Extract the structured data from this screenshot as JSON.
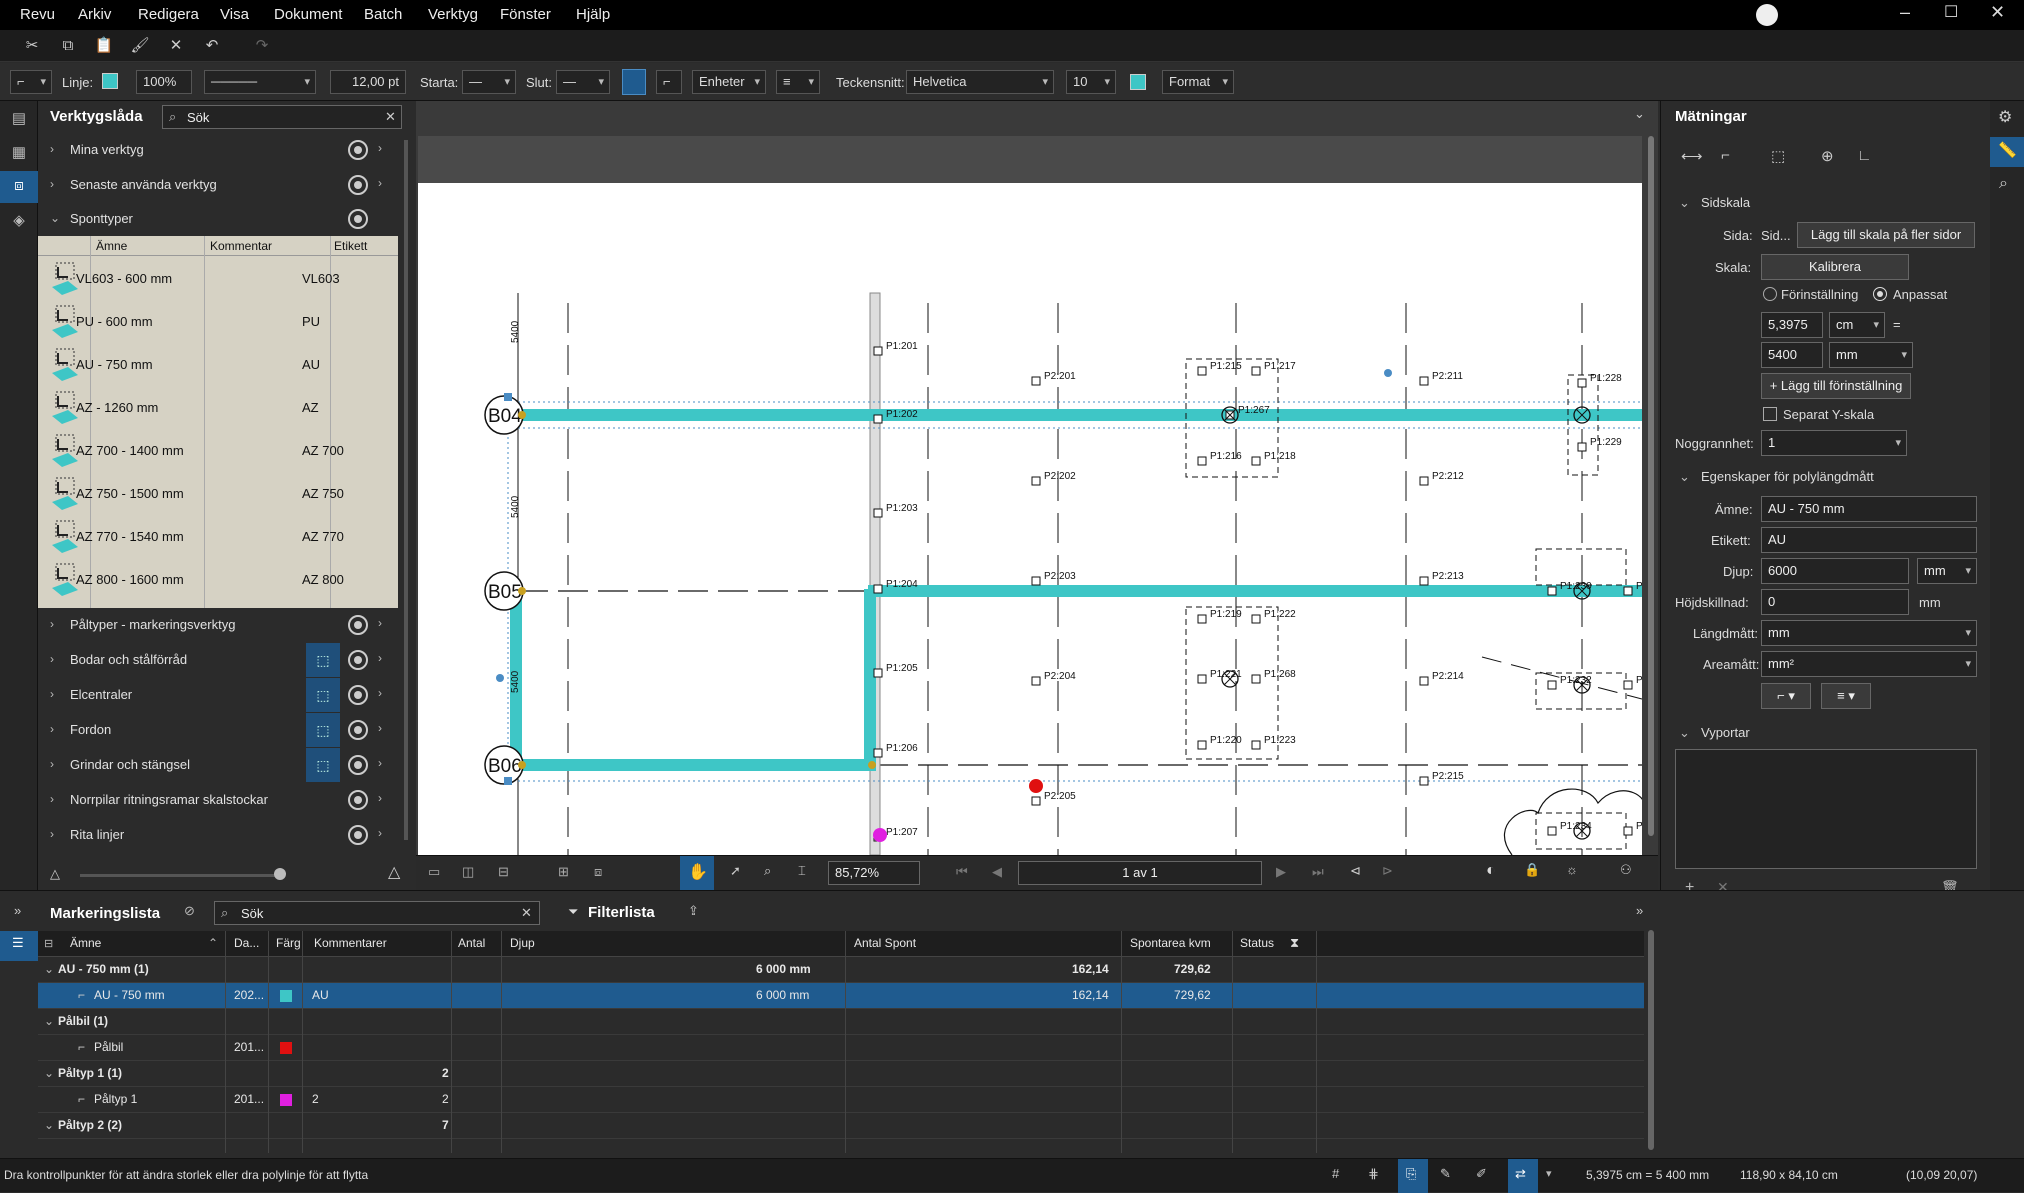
{
  "menubar": {
    "items": [
      "Revu",
      "Arkiv",
      "Redigera",
      "Visa",
      "Dokument",
      "Batch",
      "Verktyg",
      "Fönster",
      "Hjälp"
    ]
  },
  "propbar": {
    "line_label": "Linje:",
    "opacity": "100%",
    "line_width": "12,00 pt",
    "start_label": "Starta:",
    "end_label": "Slut:",
    "units": "Enheter",
    "font_label": "Teckensnitt:",
    "font_value": "Helvetica",
    "font_size": "10",
    "format": "Format"
  },
  "toolbox": {
    "title": "Verktygslåda",
    "search_placeholder": "Sök",
    "groups_top": [
      {
        "label": "Mina verktyg"
      },
      {
        "label": "Senaste använda verktyg"
      },
      {
        "label": "Sponttyper"
      }
    ],
    "columns": [
      "Ämne",
      "Kommentar",
      "Etikett"
    ],
    "spont_rows": [
      {
        "name": "VL603 - 600 mm",
        "label": "VL603"
      },
      {
        "name": "PU - 600 mm",
        "label": "PU"
      },
      {
        "name": "AU - 750 mm",
        "label": "AU"
      },
      {
        "name": "AZ - 1260 mm",
        "label": "AZ"
      },
      {
        "name": "AZ 700 - 1400 mm",
        "label": "AZ 700"
      },
      {
        "name": "AZ 750 - 1500 mm",
        "label": "AZ 750"
      },
      {
        "name": "AZ 770 - 1540 mm",
        "label": "AZ 770"
      },
      {
        "name": "AZ 800 - 1600 mm",
        "label": "AZ 800"
      }
    ],
    "groups_bottom": [
      {
        "label": "Påltyper - markeringsverktyg"
      },
      {
        "label": "Bodar och stålförråd"
      },
      {
        "label": "Elcentraler"
      },
      {
        "label": "Fordon"
      },
      {
        "label": "Grindar och stängsel"
      },
      {
        "label": "Norrpilar ritningsramar skalstockar"
      },
      {
        "label": "Rita linjer"
      }
    ]
  },
  "drawing": {
    "grid_labels": [
      "B04",
      "B05",
      "B06"
    ],
    "dims": [
      "5400",
      "5400",
      "5400"
    ],
    "points": [
      "P1:201",
      "P1:202",
      "P1:203",
      "P1:204",
      "P1:205",
      "P1:206",
      "P1:207",
      "P2:201",
      "P2:202",
      "P2:203",
      "P2:204",
      "P2:205",
      "P1:215",
      "P1:217",
      "P1:267",
      "P1:216",
      "P1:218",
      "P1:219",
      "P1:222",
      "P1:221",
      "P1:268",
      "P1:220",
      "P1:223",
      "P2:211",
      "P2:212",
      "P2:213",
      "P2:214",
      "P2:215",
      "P1:228",
      "P1:229",
      "P1:230",
      "P1:232",
      "P1:234",
      "P1",
      "P1",
      "P1"
    ]
  },
  "navbar": {
    "zoom": "85,72%",
    "page": "1 av 1"
  },
  "measurements": {
    "title": "Mätningar",
    "scale_section": "Sidskala",
    "page_label": "Sida:",
    "page_value": "Sid...",
    "apply_scale_btn": "Lägg till skala på fler sidor",
    "scale_label": "Skala:",
    "calibrate_btn": "Kalibrera",
    "preset_label": "Förinställning",
    "custom_label": "Anpassat",
    "scale_value1": "5,3975",
    "unit1": "cm",
    "equals": "=",
    "scale_value2": "5400",
    "unit2": "mm",
    "add_preset_btn": "+ Lägg till förinställning",
    "separate_y": "Separat Y-skala",
    "precision_label": "Noggrannhet:",
    "precision_value": "1",
    "poly_section": "Egenskaper för polylängdmått",
    "subject_label": "Ämne:",
    "subject_value": "AU - 750 mm",
    "label_label": "Etikett:",
    "label_value": "AU",
    "depth_label": "Djup:",
    "depth_value": "6000",
    "depth_unit": "mm",
    "height_label": "Höjdskillnad:",
    "height_value": "0",
    "height_unit": "mm",
    "length_label": "Längdmått:",
    "length_value": "mm",
    "area_label": "Areamått:",
    "area_value": "mm²",
    "cutouts_section": "Vyportar"
  },
  "markuplist": {
    "title": "Markeringslista",
    "search_placeholder": "Sök",
    "filter": "Filterlista",
    "columns": [
      "Ämne",
      "Da...",
      "Färg",
      "Kommentarer",
      "Antal",
      "Djup",
      "Antal Spont",
      "Spontarea kvm",
      "Status"
    ],
    "rows": [
      {
        "type": "group",
        "subject": "AU - 750 mm (1)",
        "depth": "6 000 mm",
        "spont": "162,14",
        "area": "729,62"
      },
      {
        "type": "item",
        "subject": "AU - 750 mm",
        "date": "202...",
        "color": "#3ec6c6",
        "comment": "AU",
        "depth": "6 000 mm",
        "spont": "162,14",
        "area": "729,62"
      },
      {
        "type": "group",
        "subject": "Pålbil (1)"
      },
      {
        "type": "item",
        "subject": "Pålbil",
        "date": "201...",
        "color": "#e01010"
      },
      {
        "type": "group",
        "subject": "Påltyp 1 (1)",
        "count": "2"
      },
      {
        "type": "item",
        "subject": "Påltyp 1",
        "date": "201...",
        "color": "#e020e0",
        "comment": "2",
        "count": "2"
      },
      {
        "type": "group",
        "subject": "Påltyp 2 (2)",
        "count": "7"
      }
    ]
  },
  "status": {
    "hint": "Dra kontrollpunkter för att ändra storlek eller dra polylinje för att flytta",
    "scale": "5,3975 cm = 5 400 mm",
    "size": "118,90 x 84,10 cm",
    "coords": "(10,09  20,07)"
  },
  "colors": {
    "accent": "#1f5b8f",
    "spont_teal": "#3ec6c6",
    "table_bg": "#d6d2c4"
  }
}
